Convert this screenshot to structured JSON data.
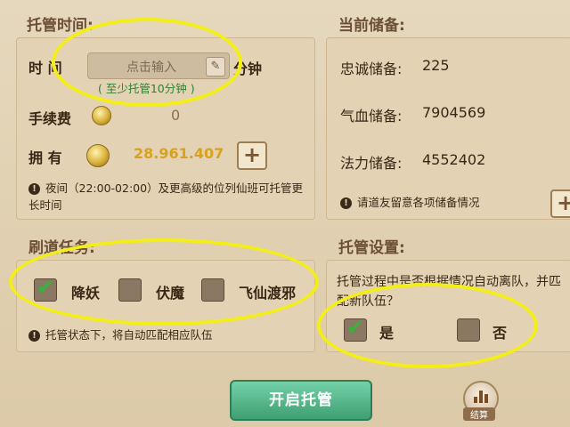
{
  "trust_time": {
    "title": "托管时间:",
    "time_label": "时 间",
    "input_placeholder": "点击输入",
    "minutes_unit": "分钟",
    "min_hint": "( 至少托管10分钟 )",
    "fee_label": "手续费",
    "fee_value": "0",
    "own_label": "拥 有",
    "own_value": "28.961.407",
    "note": "夜间（22:00-02:00）及更高级的位列仙班可托管更长时间"
  },
  "reserves": {
    "title": "当前储备:",
    "items": [
      {
        "label": "忠诚储备:",
        "value": "225"
      },
      {
        "label": "气血储备:",
        "value": "7904569"
      },
      {
        "label": "法力储备:",
        "value": "4552402"
      }
    ],
    "note": "请道友留意各项储备情况"
  },
  "tasks": {
    "title": "刷道任务:",
    "options": [
      {
        "label": "降妖",
        "checked": true
      },
      {
        "label": "伏魔",
        "checked": false
      },
      {
        "label": "飞仙渡邪",
        "checked": false
      }
    ],
    "note": "托管状态下，将自动匹配相应队伍"
  },
  "settings": {
    "title": "托管设置:",
    "question": "托管过程中是否根据情况自动离队，并匹配新队伍？",
    "options": [
      {
        "label": "是",
        "checked": true
      },
      {
        "label": "否",
        "checked": false
      }
    ]
  },
  "footer": {
    "start_button": "开启托管",
    "stats_label": "结算"
  },
  "colors": {
    "annotation": "#f3ee18",
    "own_value": "#d8a21c",
    "button": "#3ea073"
  }
}
